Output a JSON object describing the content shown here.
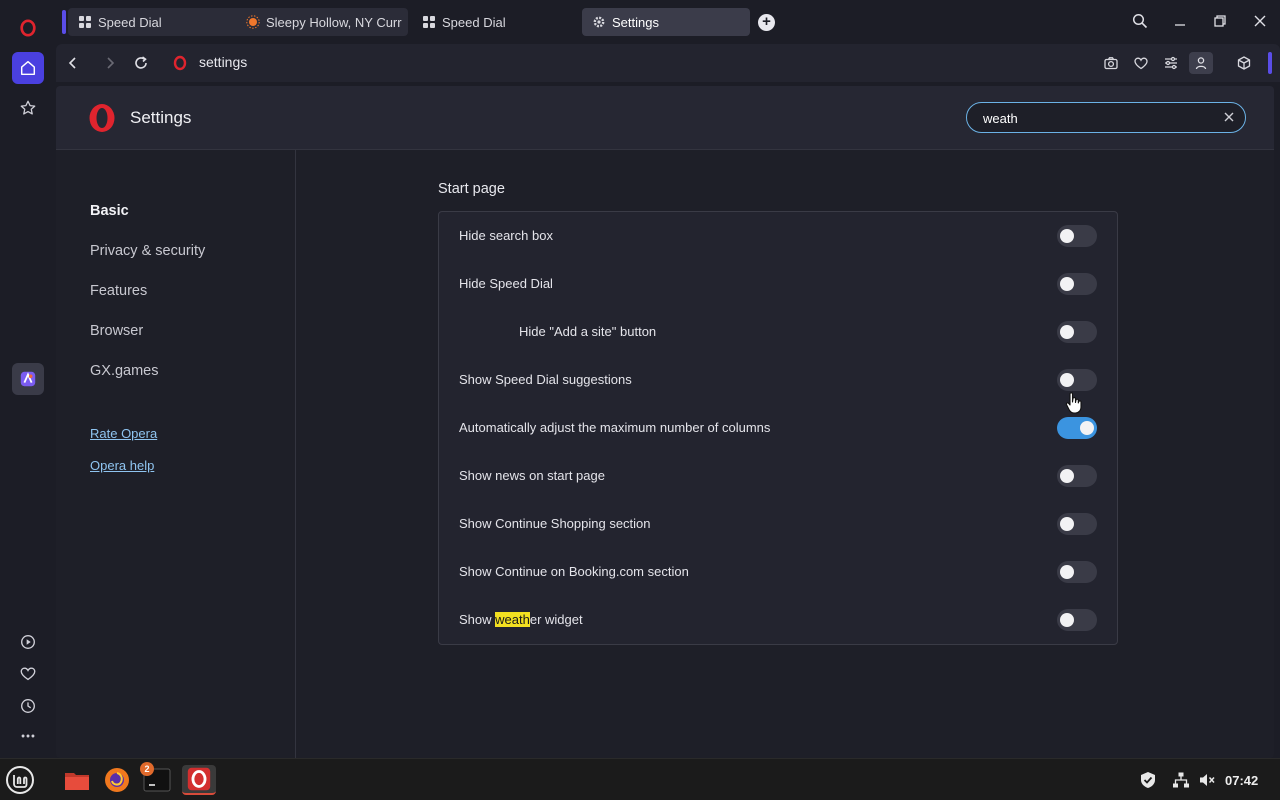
{
  "browser": {
    "tabs": [
      {
        "label": "Speed Dial",
        "icon": "grid-icon"
      },
      {
        "label": "Sleepy Hollow, NY Curr",
        "icon": "weather-sun-icon"
      },
      {
        "label": "Speed Dial",
        "icon": "grid-icon"
      },
      {
        "label": "Settings",
        "icon": "gear-icon"
      }
    ],
    "address": "settings"
  },
  "settings": {
    "title": "Settings",
    "search": {
      "value": "weath"
    },
    "nav": {
      "items": [
        "Basic",
        "Privacy & security",
        "Features",
        "Browser",
        "GX.games"
      ],
      "selected": "Basic",
      "links": [
        "Rate Opera",
        "Opera help"
      ]
    },
    "section_title": "Start page",
    "options": [
      {
        "label": "Hide search box",
        "on": false
      },
      {
        "label": "Hide Speed Dial",
        "on": false
      },
      {
        "label": "Hide \"Add a site\" button",
        "on": false,
        "indented": true
      },
      {
        "label": "Show Speed Dial suggestions",
        "on": false
      },
      {
        "label": "Automatically adjust the maximum number of columns",
        "on": true
      },
      {
        "label": "Show news on start page",
        "on": false
      },
      {
        "label": "Show Continue Shopping section",
        "on": false
      },
      {
        "label": "Show Continue on Booking.com section",
        "on": false
      },
      {
        "label_pre": "Show ",
        "label_highlight": "weath",
        "label_post": "er widget",
        "on": false
      }
    ]
  },
  "taskbar": {
    "badge": "2",
    "clock": "07:42"
  },
  "colors": {
    "accent": "#5a4de8",
    "toggle_on": "#3b94e0",
    "highlight": "#f3e021",
    "opera_red": "#e0242e"
  }
}
